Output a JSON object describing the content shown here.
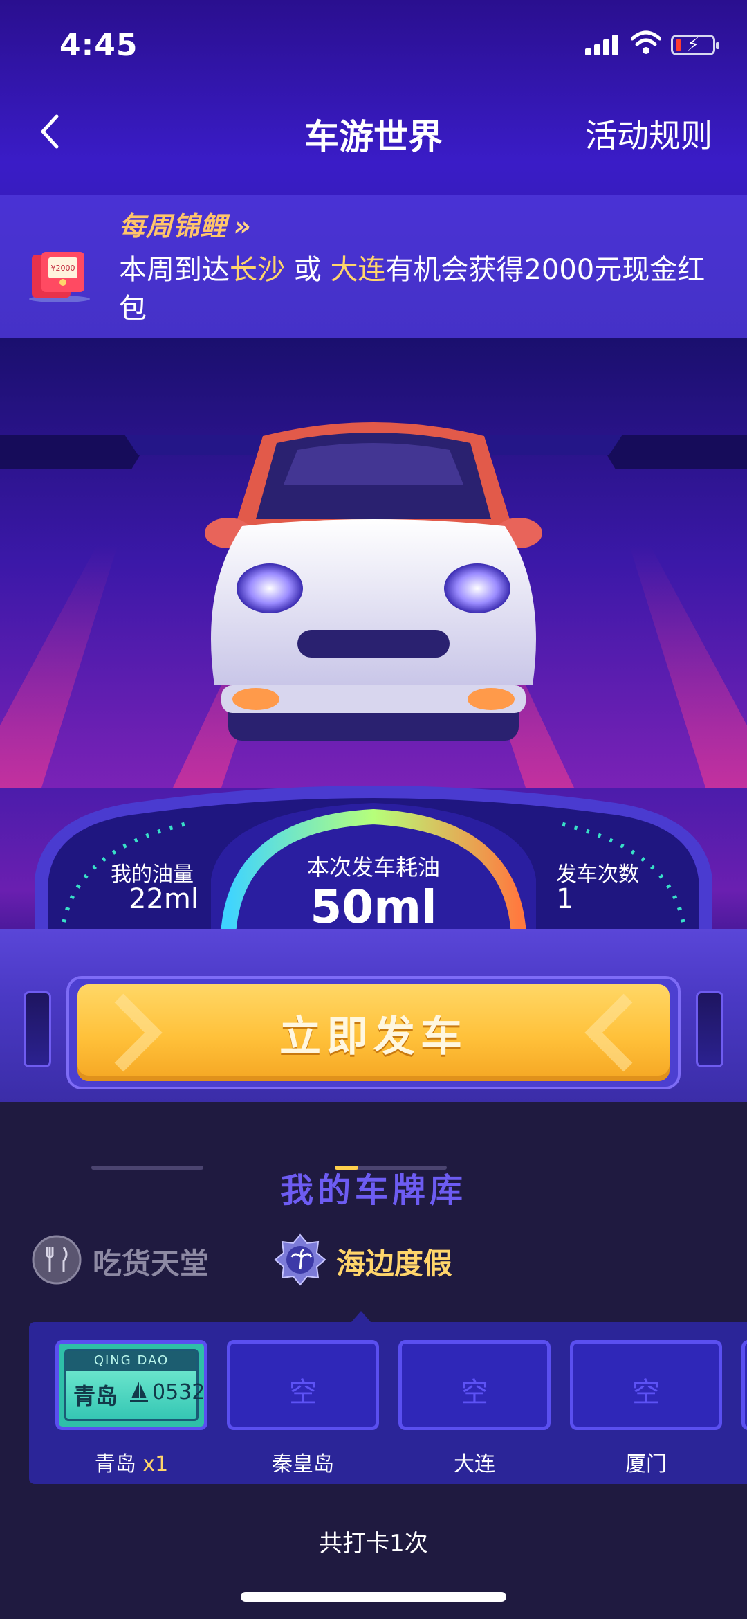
{
  "status_bar": {
    "time": "4:45"
  },
  "nav": {
    "title": "车游世界",
    "rules_label": "活动规则"
  },
  "banner": {
    "tag": "每周锦鲤",
    "tag_chevron": "»",
    "text_prefix": "本周到达",
    "city1": "长沙",
    "or": " 或 ",
    "city2": "大连",
    "text_suffix": "有机会获得2000元现金红包",
    "redpacket_amount": "¥2000"
  },
  "dashboard": {
    "fuel_label": "我的油量",
    "fuel_value": "22ml",
    "consume_label": "本次发车耗油",
    "consume_value": "50ml",
    "launch_label": "发车次数",
    "launch_value": "1"
  },
  "go_button": {
    "label": "立即发车"
  },
  "library": {
    "title": "我的车牌库",
    "tabs": [
      {
        "label": "吃货天堂",
        "active": false
      },
      {
        "label": "海边度假",
        "active": true
      }
    ],
    "slots": [
      {
        "label": "青岛",
        "count_text": "x1",
        "plate_top": "QING DAO",
        "plate_name": "青岛",
        "plate_code": "0532",
        "filled": true
      },
      {
        "label": "秦皇岛",
        "empty_text": "空",
        "filled": false
      },
      {
        "label": "大连",
        "empty_text": "空",
        "filled": false
      },
      {
        "label": "厦门",
        "empty_text": "空",
        "filled": false
      }
    ],
    "total": "共打卡1次"
  },
  "colors": {
    "accent_yellow": "#ffc13a",
    "highlight": "#ffd56b",
    "purple": "#6d5cf2"
  }
}
